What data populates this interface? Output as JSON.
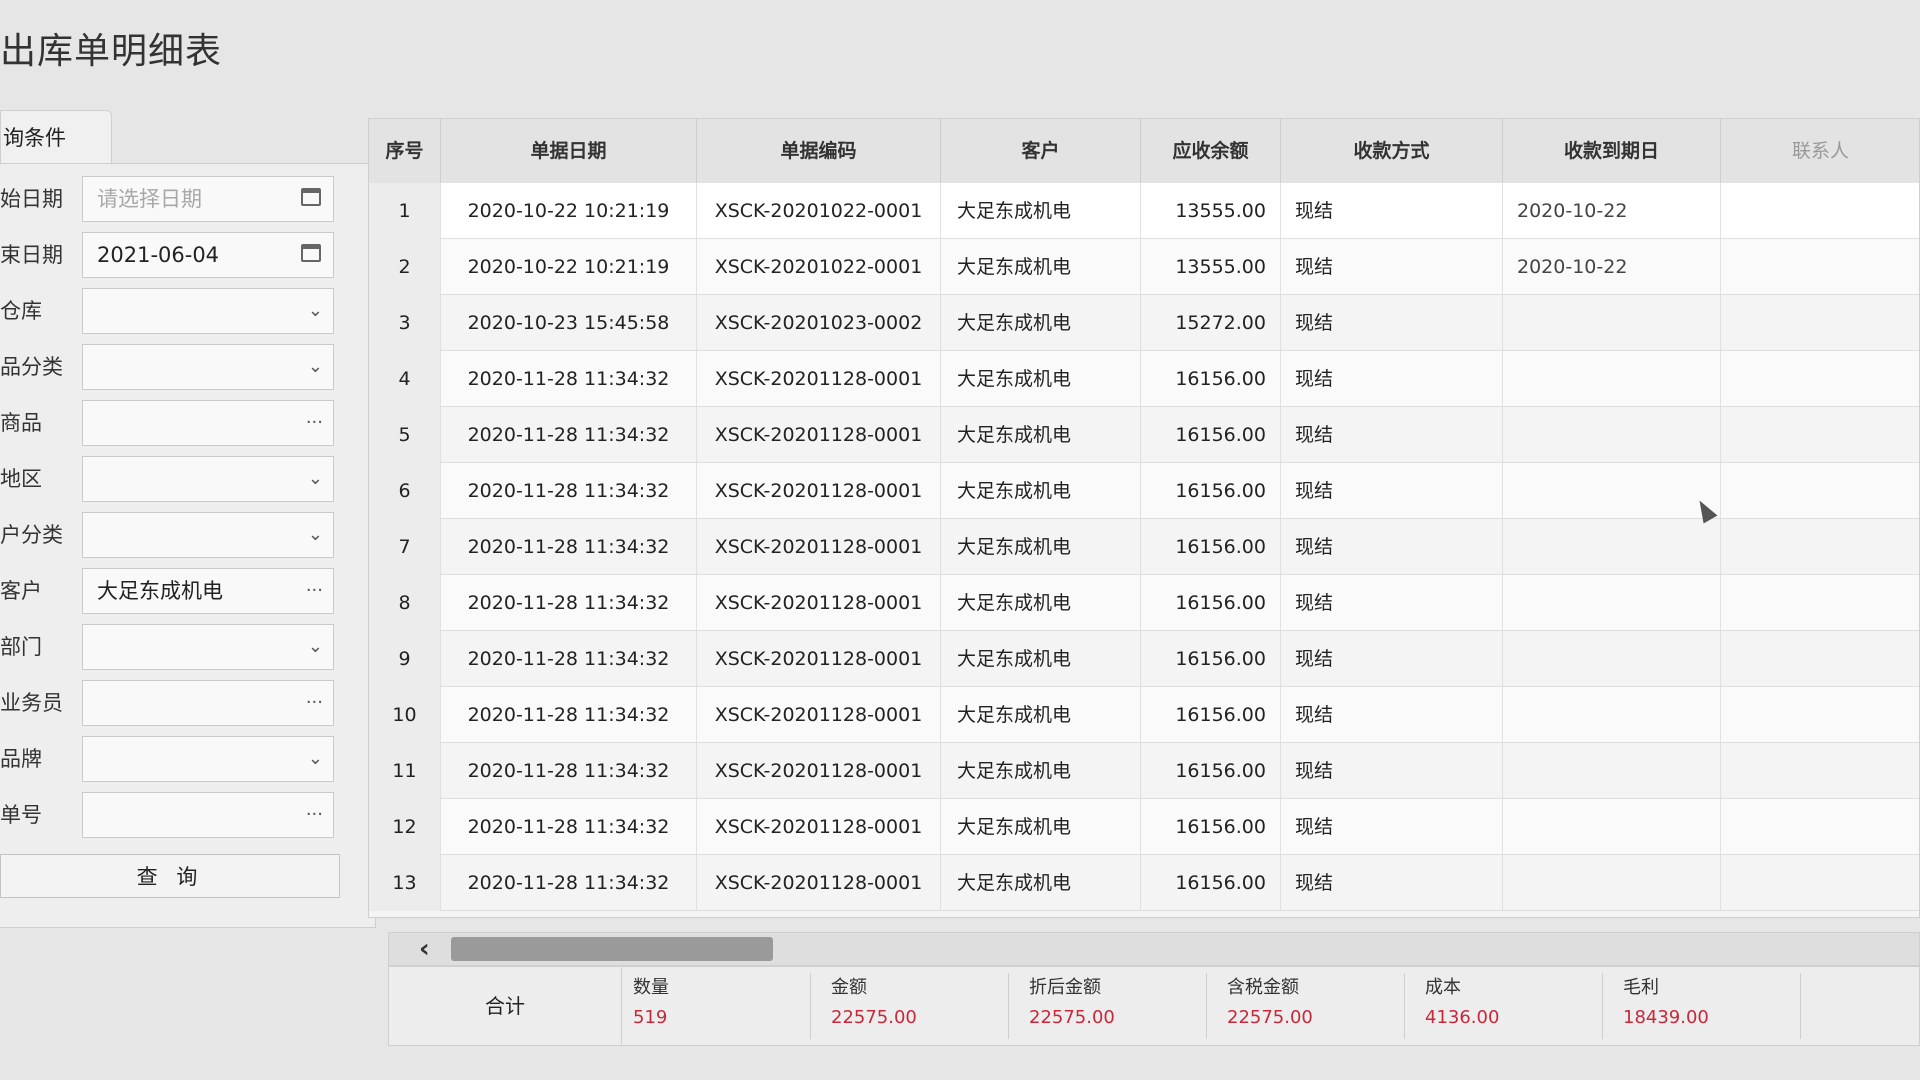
{
  "page": {
    "title": "出库单明细表"
  },
  "filter": {
    "tab_label": "询条件",
    "rows": [
      {
        "label": "始日期",
        "value": "",
        "placeholder": "请选择日期",
        "control": "date"
      },
      {
        "label": "束日期",
        "value": "2021-06-04",
        "placeholder": "",
        "control": "date"
      },
      {
        "label": "仓库",
        "value": "",
        "placeholder": "",
        "control": "dropdown"
      },
      {
        "label": "品分类",
        "value": "",
        "placeholder": "",
        "control": "dropdown"
      },
      {
        "label": "商品",
        "value": "",
        "placeholder": "",
        "control": "picker"
      },
      {
        "label": "地区",
        "value": "",
        "placeholder": "",
        "control": "dropdown"
      },
      {
        "label": "户分类",
        "value": "",
        "placeholder": "",
        "control": "dropdown"
      },
      {
        "label": "客户",
        "value": "大足东成机电",
        "placeholder": "",
        "control": "picker"
      },
      {
        "label": "部门",
        "value": "",
        "placeholder": "",
        "control": "dropdown"
      },
      {
        "label": "业务员",
        "value": "",
        "placeholder": "",
        "control": "picker"
      },
      {
        "label": "品牌",
        "value": "",
        "placeholder": "",
        "control": "dropdown"
      },
      {
        "label": "单号",
        "value": "",
        "placeholder": "",
        "control": "picker"
      }
    ],
    "query_button": "查 询"
  },
  "grid": {
    "columns": [
      "序号",
      "单据日期",
      "单据编码",
      "客户",
      "应收余额",
      "收款方式",
      "收款到期日",
      "联系人"
    ],
    "rows": [
      [
        "1",
        "2020-10-22 10:21:19",
        "XSCK-20201022-0001",
        "大足东成机电",
        "13555.00",
        "现结",
        "2020-10-22"
      ],
      [
        "2",
        "2020-10-22 10:21:19",
        "XSCK-20201022-0001",
        "大足东成机电",
        "13555.00",
        "现结",
        "2020-10-22"
      ],
      [
        "3",
        "2020-10-23 15:45:58",
        "XSCK-20201023-0002",
        "大足东成机电",
        "15272.00",
        "现结",
        ""
      ],
      [
        "4",
        "2020-11-28 11:34:32",
        "XSCK-20201128-0001",
        "大足东成机电",
        "16156.00",
        "现结",
        ""
      ],
      [
        "5",
        "2020-11-28 11:34:32",
        "XSCK-20201128-0001",
        "大足东成机电",
        "16156.00",
        "现结",
        ""
      ],
      [
        "6",
        "2020-11-28 11:34:32",
        "XSCK-20201128-0001",
        "大足东成机电",
        "16156.00",
        "现结",
        ""
      ],
      [
        "7",
        "2020-11-28 11:34:32",
        "XSCK-20201128-0001",
        "大足东成机电",
        "16156.00",
        "现结",
        ""
      ],
      [
        "8",
        "2020-11-28 11:34:32",
        "XSCK-20201128-0001",
        "大足东成机电",
        "16156.00",
        "现结",
        ""
      ],
      [
        "9",
        "2020-11-28 11:34:32",
        "XSCK-20201128-0001",
        "大足东成机电",
        "16156.00",
        "现结",
        ""
      ],
      [
        "10",
        "2020-11-28 11:34:32",
        "XSCK-20201128-0001",
        "大足东成机电",
        "16156.00",
        "现结",
        ""
      ],
      [
        "11",
        "2020-11-28 11:34:32",
        "XSCK-20201128-0001",
        "大足东成机电",
        "16156.00",
        "现结",
        ""
      ],
      [
        "12",
        "2020-11-28 11:34:32",
        "XSCK-20201128-0001",
        "大足东成机电",
        "16156.00",
        "现结",
        ""
      ],
      [
        "13",
        "2020-11-28 11:34:32",
        "XSCK-20201128-0001",
        "大足东成机电",
        "16156.00",
        "现结",
        ""
      ]
    ]
  },
  "totals": {
    "label": "合计",
    "items": [
      {
        "name": "数量",
        "value": "519"
      },
      {
        "name": "金额",
        "value": "22575.00"
      },
      {
        "name": "折后金额",
        "value": "22575.00"
      },
      {
        "name": "含税金额",
        "value": "22575.00"
      },
      {
        "name": "成本",
        "value": "4136.00"
      },
      {
        "name": "毛利",
        "value": "18439.00"
      }
    ]
  },
  "colors": {
    "accent_red": "#c8283a",
    "header_bg": "#e3e3e3"
  }
}
